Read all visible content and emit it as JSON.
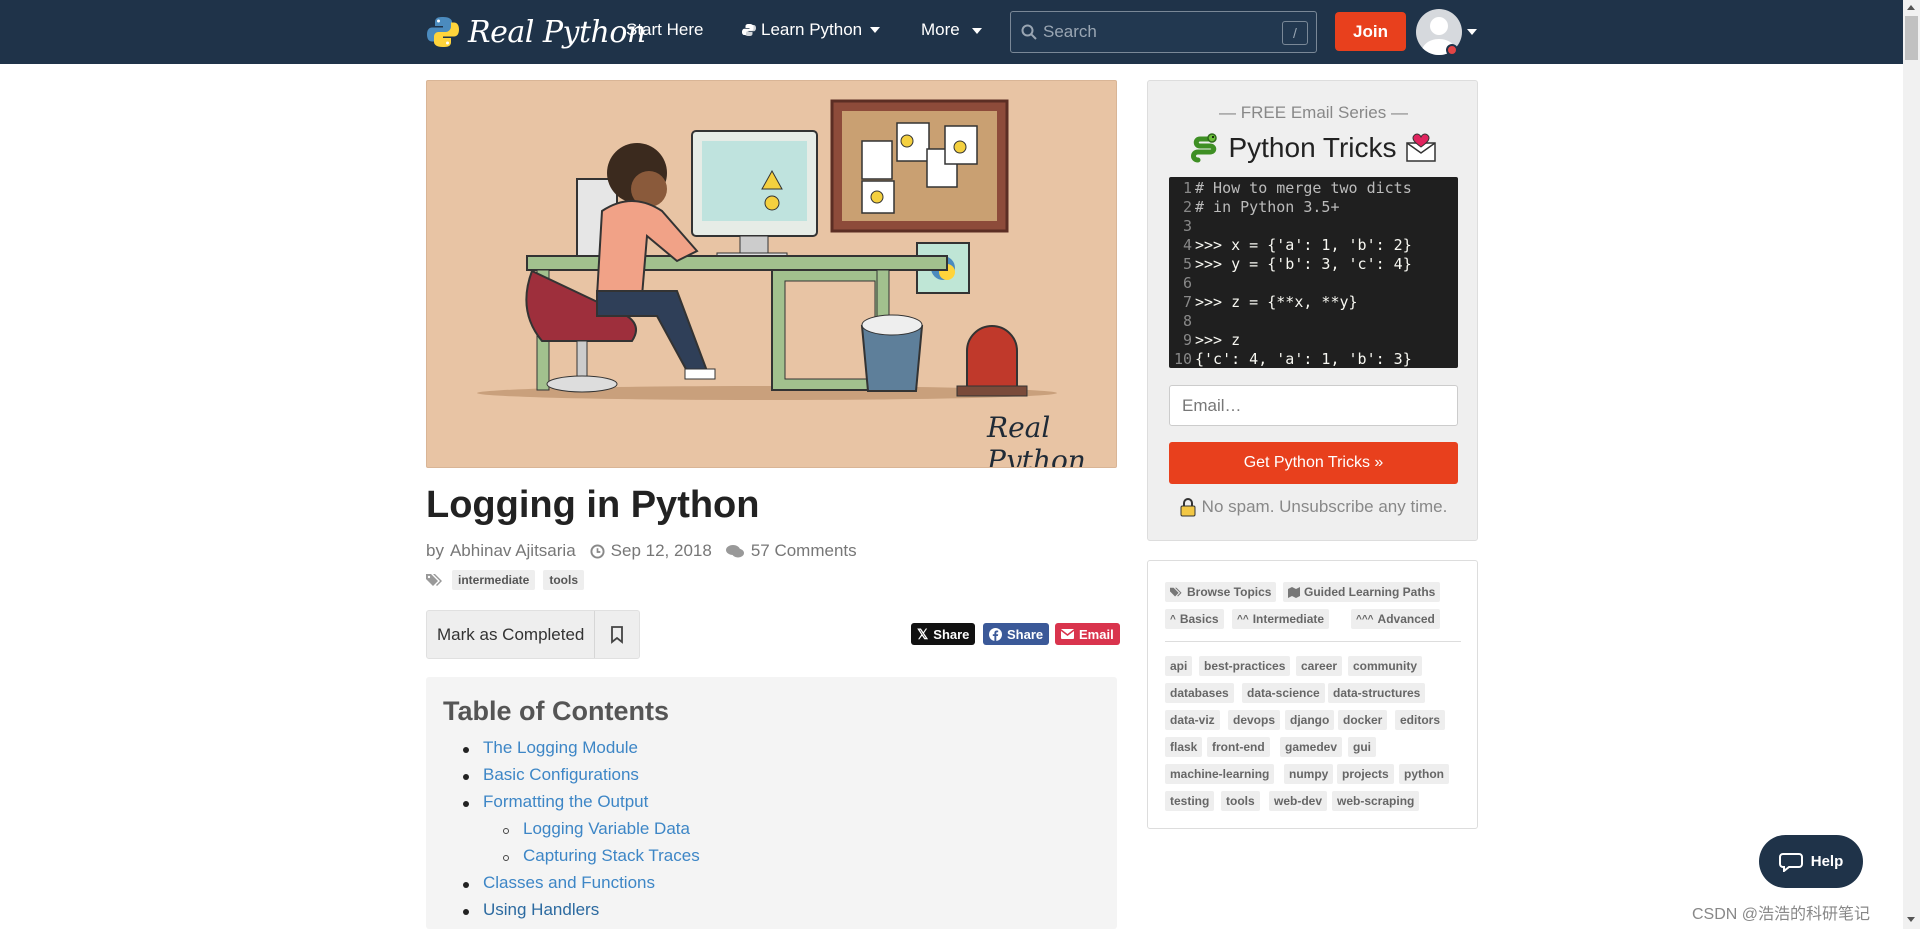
{
  "header": {
    "brand": "Real Python",
    "nav": {
      "start_here": "Start Here",
      "learn_python": "Learn Python",
      "more": "More"
    },
    "search": {
      "placeholder": "Search",
      "shortcut": "/"
    },
    "join_label": "Join"
  },
  "article": {
    "hero_brand": "Real Python",
    "title": "Logging in Python",
    "author_prefix": "by",
    "author": "Abhinav Ajitsaria",
    "date": "Sep 12, 2018",
    "comments": "57 Comments",
    "tags": [
      "intermediate",
      "tools"
    ],
    "mark_completed": "Mark as Completed",
    "share": {
      "x_label": "Share",
      "facebook_label": "Share",
      "email_label": "Email"
    },
    "toc": {
      "title": "Table of Contents",
      "items": [
        "The Logging Module",
        "Basic Configurations",
        "Formatting the Output",
        "Logging Variable Data",
        "Capturing Stack Traces",
        "Classes and Functions",
        "Using Handlers"
      ]
    }
  },
  "sidebar": {
    "email": {
      "kicker": "— FREE Email Series —",
      "title": "Python Tricks",
      "code_lines": [
        {
          "n": "1",
          "t": "# How to merge two dicts"
        },
        {
          "n": "2",
          "t": "# in Python 3.5+"
        },
        {
          "n": "3",
          "t": ""
        },
        {
          "n": "4",
          "t": ">>> x = {'a': 1, 'b': 2}"
        },
        {
          "n": "5",
          "t": ">>> y = {'b': 3, 'c': 4}"
        },
        {
          "n": "6",
          "t": ""
        },
        {
          "n": "7",
          "t": ">>> z = {**x, **y}"
        },
        {
          "n": "8",
          "t": ""
        },
        {
          "n": "9",
          "t": ">>> z"
        },
        {
          "n": "10",
          "t": "{'c': 4, 'a': 1, 'b': 3}"
        }
      ],
      "input_placeholder": "Email…",
      "button": "Get Python Tricks »",
      "nospam": "No spam. Unsubscribe any time."
    },
    "topics": {
      "browse": "Browse Topics",
      "paths": "Guided Learning Paths",
      "basics": "Basics",
      "intermediate": "Intermediate",
      "advanced": "Advanced",
      "tags": [
        "api",
        "best-practices",
        "career",
        "community",
        "databases",
        "data-science",
        "data-structures",
        "data-viz",
        "devops",
        "django",
        "docker",
        "editors",
        "flask",
        "front-end",
        "gamedev",
        "gui",
        "machine-learning",
        "numpy",
        "projects",
        "python",
        "testing",
        "tools",
        "web-dev",
        "web-scraping"
      ]
    }
  },
  "help_label": "Help",
  "watermark": "CSDN @浩浩的科研笔记",
  "colors": {
    "navbar": "#1f3349",
    "accent": "#e8401d",
    "link": "#3d86c6"
  }
}
